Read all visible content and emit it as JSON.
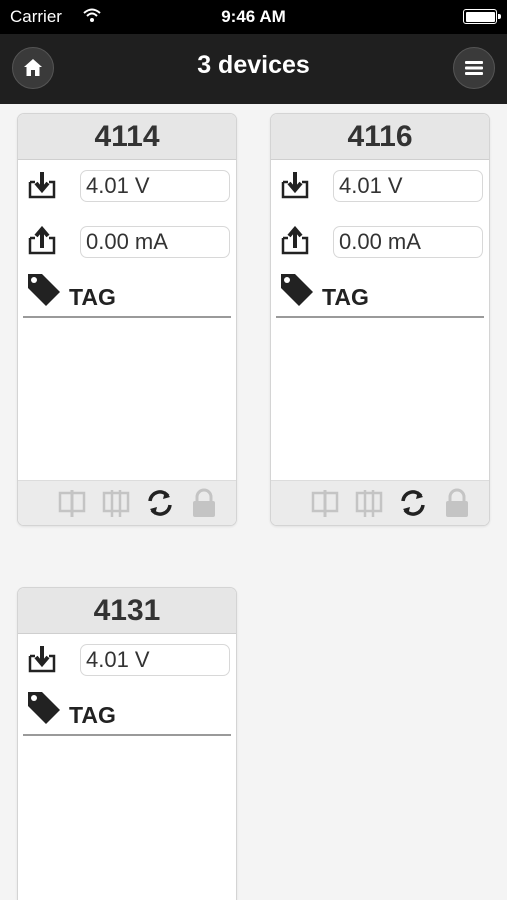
{
  "status_bar": {
    "carrier": "Carrier",
    "time": "9:46 AM"
  },
  "nav": {
    "title": "3 devices",
    "left_icon": "home-icon",
    "right_icon": "hamburger-menu-icon"
  },
  "devices": [
    {
      "id": "4114",
      "input_value": "4.01 V",
      "output_value": "0.00 mA",
      "tag_label": "TAG"
    },
    {
      "id": "4116",
      "input_value": "4.01 V",
      "output_value": "0.00 mA",
      "tag_label": "TAG"
    },
    {
      "id": "4131",
      "input_value": "4.01 V",
      "tag_label": "TAG"
    }
  ],
  "footer_icons": [
    "display-front-icon",
    "display-back-icon",
    "refresh-icon",
    "lock-icon"
  ],
  "colors": {
    "nav_background": "#1f1f1f",
    "card_header": "#e6e6e6",
    "page_background": "#f4f4f4"
  }
}
